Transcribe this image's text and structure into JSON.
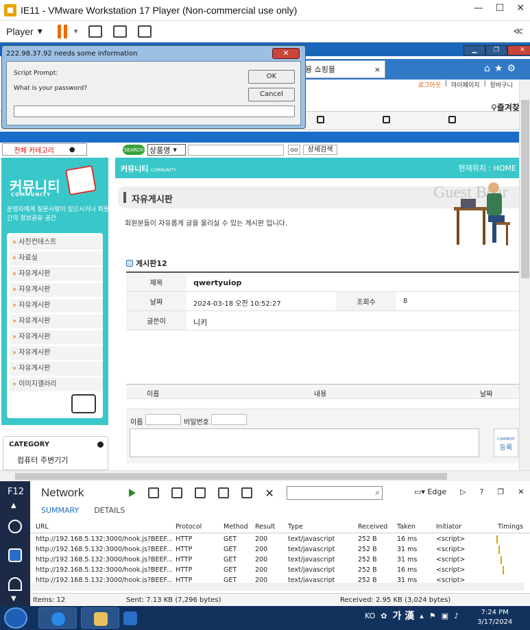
{
  "vm": {
    "title": "IE11 - VMware Workstation 17 Player (Non-commercial use only)",
    "player_label": "Player",
    "collapse_glyph": "≪"
  },
  "dialog": {
    "title": "222.98.37.92 needs some information",
    "prompt_label": "Script Prompt:",
    "question": "What is your password?",
    "ok_label": "OK",
    "cancel_label": "Cancel",
    "input_value": ""
  },
  "ie": {
    "tab_label": "쇼핑몰",
    "tab_label_prefix": "용",
    "close_glyph": "×"
  },
  "site": {
    "top_links": {
      "logout": "로그아웃",
      "mypage": "마이페이지",
      "cart": "장바구니"
    },
    "favorite": "즐겨찾",
    "category_button": "전체 카테고리",
    "search_badge": "SEARCH",
    "search_select": "상품명",
    "go_label": "GO",
    "detail_search": "상세검색",
    "left": {
      "title": "커뮤니티",
      "subtitle": "COMMUNITY",
      "desc": "운영자에게 질문사항이 있으시거나 회원간의 정보공유 공간",
      "menu": [
        "사진컨테스트",
        "자료실",
        "자유게시판",
        "자유게시판",
        "자유게시판",
        "자유게시판",
        "자유게시판",
        "자유게시판",
        "자유게시판",
        "이미지갤러리"
      ]
    },
    "category": {
      "title": "CATEGORY",
      "item": "컴퓨터 주변기기"
    },
    "breadcrumb_left": "커뮤니티",
    "breadcrumb_left_small": "COMMUNITY",
    "breadcrumb_right": "현재위치 : HOME",
    "board_title": "자유게시판",
    "guest_text": "Guest Boar",
    "board_desc": "회원분들이 자유롭게 글을 올리실 수 있는 게시판 입니다.",
    "board_no": "게시판12",
    "post": {
      "subject_label": "제목",
      "subject": "qwertyuiop",
      "date_label": "날짜",
      "date": "2024-03-18 오전 10:52:27",
      "views_label": "조회수",
      "views": "8",
      "author_label": "글쓴이",
      "author": "니키"
    },
    "comments": {
      "col_name": "이름",
      "col_content": "내용",
      "col_date": "날짜",
      "name_label": "이름",
      "password_label": "비밀번호",
      "register_small": "COMMENT",
      "register": "등록"
    }
  },
  "devtools": {
    "f12": "F12",
    "tool": "Network",
    "tabs": [
      "SUMMARY",
      "DETAILS"
    ],
    "mode": "Edge",
    "help": "?",
    "columns": [
      "URL",
      "Protocol",
      "Method",
      "Result",
      "Type",
      "Received",
      "Taken",
      "Initiator",
      "Timings"
    ],
    "rows": [
      [
        "http://192.168.5.132:3000/hook.js?BEEF...",
        "HTTP",
        "GET",
        "200",
        "text/javascript",
        "252 B",
        "16 ms",
        "<script>"
      ],
      [
        "http://192.168.5.132:3000/hook.js?BEEF...",
        "HTTP",
        "GET",
        "200",
        "text/javascript",
        "252 B",
        "31 ms",
        "<script>"
      ],
      [
        "http://192.168.5.132:3000/hook.js?BEEF...",
        "HTTP",
        "GET",
        "200",
        "text/javascript",
        "252 B",
        "31 ms",
        "<script>"
      ],
      [
        "http://192.168.5.132:3000/hook.js?BEEF...",
        "HTTP",
        "GET",
        "200",
        "text/javascript",
        "252 B",
        "16 ms",
        "<script>"
      ],
      [
        "http://192.168.5.132:3000/hook.js?BEEF...",
        "HTTP",
        "GET",
        "200",
        "text/javascript",
        "252 B",
        "31 ms",
        "<script>"
      ]
    ],
    "status": {
      "items": "Items: 12",
      "sent": "Sent: 7.13 KB (7,296 bytes)",
      "received": "Received: 2.95 KB (3,024 bytes)"
    }
  },
  "taskbar": {
    "lang": "KO",
    "ime": "가 漢",
    "time": "7:24 PM",
    "date": "3/17/2024"
  },
  "colors": {
    "teal": "#3ac7c9",
    "ie_blue": "#1b6ec8",
    "taskbar": "#12325e",
    "devside": "#1c2a48"
  }
}
